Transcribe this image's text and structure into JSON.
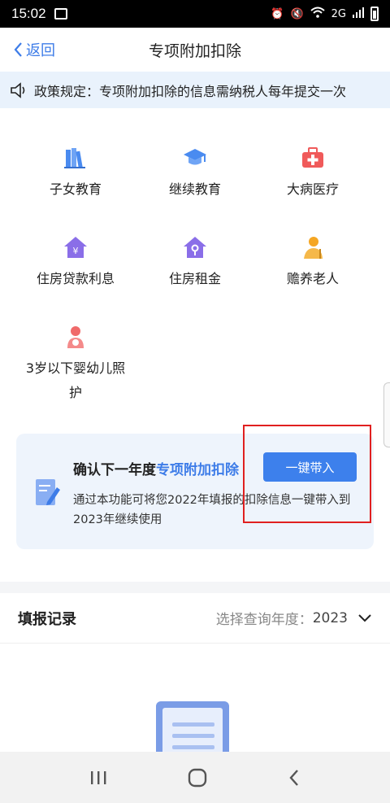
{
  "status_bar": {
    "time": "15:02",
    "network": "2G"
  },
  "nav": {
    "back_label": "返回",
    "title": "专项附加扣除"
  },
  "notice": {
    "text": "政策规定：专项附加扣除的信息需纳税人每年提交一次"
  },
  "categories": [
    {
      "label": "子女教育",
      "icon": "books-icon",
      "color": "#4a8bf0"
    },
    {
      "label": "继续教育",
      "icon": "graduation-cap-icon",
      "color": "#4a8bf0"
    },
    {
      "label": "大病医疗",
      "icon": "medical-kit-icon",
      "color": "#f05a5a"
    },
    {
      "label": "住房贷款利息",
      "icon": "house-loan-icon",
      "color": "#8a6ee8"
    },
    {
      "label": "住房租金",
      "icon": "house-key-icon",
      "color": "#8a6ee8"
    },
    {
      "label": "赡养老人",
      "icon": "elderly-icon",
      "color": "#f5a623"
    },
    {
      "label_line1": "3岁以下婴幼儿照",
      "label_line2": "护",
      "icon": "mother-baby-icon",
      "color": "#f06a6a"
    }
  ],
  "confirm_card": {
    "heading_prefix": "确认下一年度",
    "heading_highlight": "专项附加扣除",
    "button_label": "一键带入",
    "description": "通过本功能可将您2022年填报的扣除信息一键带入到2023年继续使用"
  },
  "records": {
    "title": "填报记录",
    "year_label": "选择查询年度：",
    "year_value": "2023"
  },
  "colors": {
    "accent": "#3d7ce8",
    "button": "#3d80ec",
    "highlight_border": "#e02020"
  }
}
